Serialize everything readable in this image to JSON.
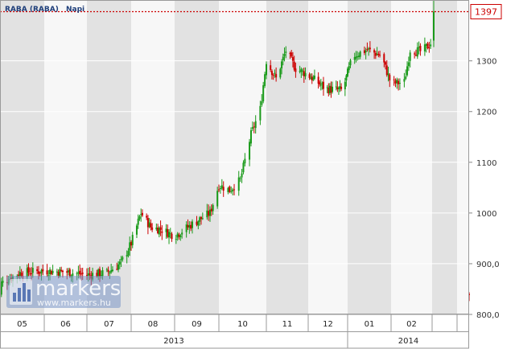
{
  "chart_data": {
    "type": "candlestick",
    "title": "RABA (RABA)",
    "subtitle": "Napi",
    "y_ticks": [
      "800,0",
      "900,0",
      "1000",
      "1100",
      "1200",
      "1300"
    ],
    "ylim": [
      800,
      1420
    ],
    "last_value": 1397,
    "months": [
      "05",
      "06",
      "07",
      "08",
      "09",
      "10",
      "11",
      "12",
      "01",
      "02"
    ],
    "years": [
      "2013",
      "2014"
    ],
    "grid": true,
    "colors": {
      "up": "#1a9a1a",
      "down": "#cc0000",
      "last_line": "#cc0000"
    },
    "series": [
      {
        "date": "2013-05-01",
        "value": 860
      },
      {
        "date": "2013-05-15",
        "value": 882
      },
      {
        "date": "2013-06-01",
        "value": 886
      },
      {
        "date": "2013-06-15",
        "value": 884
      },
      {
        "date": "2013-07-01",
        "value": 878
      },
      {
        "date": "2013-07-15",
        "value": 882
      },
      {
        "date": "2013-07-25",
        "value": 902
      },
      {
        "date": "2013-08-01",
        "value": 940
      },
      {
        "date": "2013-08-08",
        "value": 1000
      },
      {
        "date": "2013-08-15",
        "value": 972
      },
      {
        "date": "2013-08-22",
        "value": 968
      },
      {
        "date": "2013-09-01",
        "value": 955
      },
      {
        "date": "2013-09-15",
        "value": 982
      },
      {
        "date": "2013-09-25",
        "value": 1000
      },
      {
        "date": "2013-10-01",
        "value": 1055
      },
      {
        "date": "2013-10-08",
        "value": 1045
      },
      {
        "date": "2013-10-15",
        "value": 1065
      },
      {
        "date": "2013-10-22",
        "value": 1155
      },
      {
        "date": "2013-10-28",
        "value": 1205
      },
      {
        "date": "2013-11-01",
        "value": 1300
      },
      {
        "date": "2013-11-08",
        "value": 1265
      },
      {
        "date": "2013-11-15",
        "value": 1320
      },
      {
        "date": "2013-11-22",
        "value": 1285
      },
      {
        "date": "2013-12-01",
        "value": 1272
      },
      {
        "date": "2013-12-15",
        "value": 1245
      },
      {
        "date": "2013-12-28",
        "value": 1242
      },
      {
        "date": "2014-01-05",
        "value": 1310
      },
      {
        "date": "2014-01-15",
        "value": 1322
      },
      {
        "date": "2014-01-25",
        "value": 1310
      },
      {
        "date": "2014-02-01",
        "value": 1255
      },
      {
        "date": "2014-02-10",
        "value": 1258
      },
      {
        "date": "2014-02-14",
        "value": 1322
      },
      {
        "date": "2014-02-22",
        "value": 1318
      },
      {
        "date": "2014-02-28",
        "value": 1335
      },
      {
        "date": "2014-03-03",
        "value": 1397
      }
    ]
  },
  "watermark": {
    "brand": "markers",
    "url": "www.markers.hu"
  }
}
